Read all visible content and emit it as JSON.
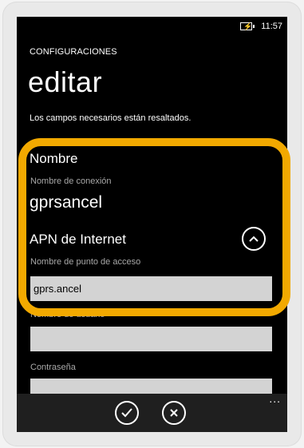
{
  "status_bar": {
    "time": "11:57",
    "battery_icon": "battery-charging-icon"
  },
  "header": {
    "section": "CONFIGURACIONES",
    "title": "editar",
    "subtitle": "Los campos necesarios están resaltados."
  },
  "form": {
    "name_section": "Nombre",
    "connection_label": "Nombre de conexión",
    "connection_value": "gprsancel",
    "apn_section": "APN de Internet",
    "apn_toggle_icon": "chevron-up-icon",
    "apn_label": "Nombre de punto de acceso",
    "apn_value": "gprs.ancel",
    "username_label": "Nombre de usuario",
    "username_value": "",
    "password_label": "Contraseña",
    "password_value": ""
  },
  "app_bar": {
    "accept_icon": "check-icon",
    "cancel_icon": "close-icon",
    "more": "..."
  },
  "colors": {
    "highlight": "#f2a900",
    "screen_bg": "#000000",
    "input_bg": "#d3d3d3"
  }
}
